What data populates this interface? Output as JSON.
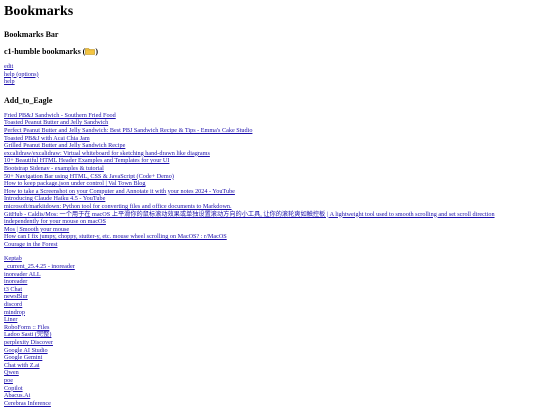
{
  "page": {
    "title": "Bookmarks",
    "bar_title": "Bookmarks Bar"
  },
  "folder": {
    "title": "c1-humble bookmarks (",
    "title_suffix": ")",
    "icon": "folder-icon",
    "links": [
      "edit",
      "help (options)",
      "help"
    ]
  },
  "add_to_eagle": {
    "title": "Add_to_Eagle",
    "links": [
      "Fried PB&J Sandwich - Southern Fried Food",
      "Toasted Peanut Butter and Jelly Sandwich",
      "Perfect Peanut Butter and Jelly Sandwich: Best PBJ Sandwich Recipe & Tips - Emma's Cake Studio",
      "Toasted PB&J with Acai Chia Jam",
      "Grilled Peanut Butter and Jelly Sandwich Recipe",
      "excalidraw/excalidraw: Virtual whiteboard for sketching hand-drawn like diagrams",
      "10+ Beautiful HTML Header Examples and Templates for your UI",
      "Bootstrap Sidenav - examples & tutorial",
      "50+ Navigation Bar using HTML, CSS & JavaScript (Code+ Demo)",
      "How to keep package.json under control | Val Town Blog",
      "How to take a Screenshot on your Computer and Annotate it with your notes 2024 - YouTube",
      "Introducing Claude Haiku 4.5 - YouTube",
      "microsoft/markitdown: Python tool for converting files and office documents to Markdown.",
      "GitHub - Caldis/Mos: 一个用于在 macOS 上平滑你的鼠标滚动效果或单独设置滚动方向的小工具, 让你的滚轮爽如触控板 | A lightweight tool used to smooth scrolling and set scroll direction independently for your mouse on macOS",
      "Mos | Smooth your mouse",
      "How can I fix jumpy, choppy, stutter-y, etc. mouse wheel scrolling on MacOS? : r/MacOS",
      "Courage in the Forest"
    ]
  },
  "misc": {
    "links": [
      "Keptab",
      "_current_25.4.25 - inoreader",
      "inoreader ALL",
      "inoreader",
      "t3 Chat",
      "newsBlur",
      "discord",
      "mindrop",
      "Liner",
      "RoboForm :: Files",
      "Ladoo Sasti (完整)",
      "perplexity Discover",
      "Google AI Studio",
      "Google Gemini",
      "Chat with Z.ai",
      "Qwen",
      "poe",
      "Copilot",
      "Abacus.Ai",
      "Cerebras Inference"
    ]
  }
}
